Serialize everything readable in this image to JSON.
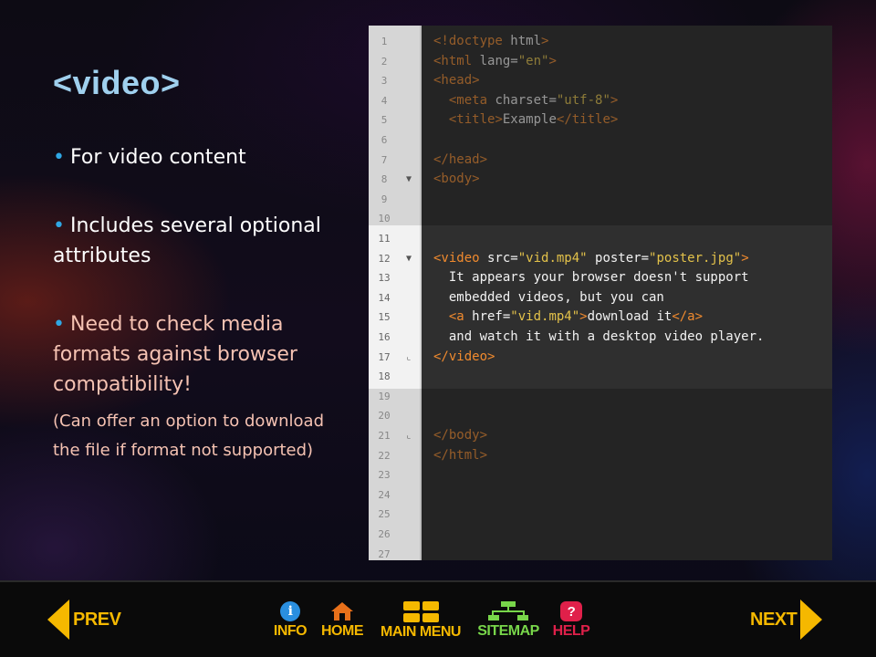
{
  "slide": {
    "title": "<video>",
    "bullets": [
      {
        "text": "For video content"
      },
      {
        "text": "Includes several optional attributes"
      },
      {
        "text": "Need to check media formats against browser compatibility!"
      }
    ],
    "note": "(Can offer an option to download the file if format not supported)",
    "bullet_marker": "•"
  },
  "code_editor": {
    "line_numbers": [
      "1",
      "2",
      "3",
      "4",
      "5",
      "6",
      "7",
      "8",
      "9",
      "10",
      "11",
      "12",
      "13",
      "14",
      "15",
      "16",
      "17",
      "18",
      "19",
      "20",
      "21",
      "22",
      "23",
      "24",
      "25",
      "26",
      "27"
    ],
    "fold_markers": {
      "8": "▼",
      "12": "▼",
      "17": "⌞",
      "21": "⌞"
    },
    "lines": {
      "1": "<!doctype html>",
      "2": "<html lang=\"en\">",
      "3": "<head>",
      "4": "  <meta charset=\"utf-8\">",
      "5": "  <title>Example</title>",
      "7": "</head>",
      "8": "<body>",
      "12": "<video src=\"vid.mp4\" poster=\"poster.jpg\">",
      "13": "  It appears your browser doesn't support",
      "14": "  embedded videos, but you can",
      "15": "  <a href=\"vid.mp4\">download it</a>",
      "16": "  and watch it with a desktop video player.",
      "17": "</video>",
      "21": "</body>",
      "22": "</html>"
    }
  },
  "nav": {
    "prev_label": "PREV",
    "info_label": "INFO",
    "home_label": "HOME",
    "main_menu_label": "MAIN MENU",
    "sitemap_label": "SITEMAP",
    "help_label": "HELP",
    "next_label": "NEXT",
    "info_glyph": "i",
    "help_glyph": "?"
  },
  "colors": {
    "title": "#9fd0ee",
    "bullet_dot": "#2fa7e4",
    "highlight_text": "#f5c2b2",
    "nav_yellow": "#f5b800",
    "code_tag": "#f08a2e",
    "code_value": "#e3c24a"
  }
}
